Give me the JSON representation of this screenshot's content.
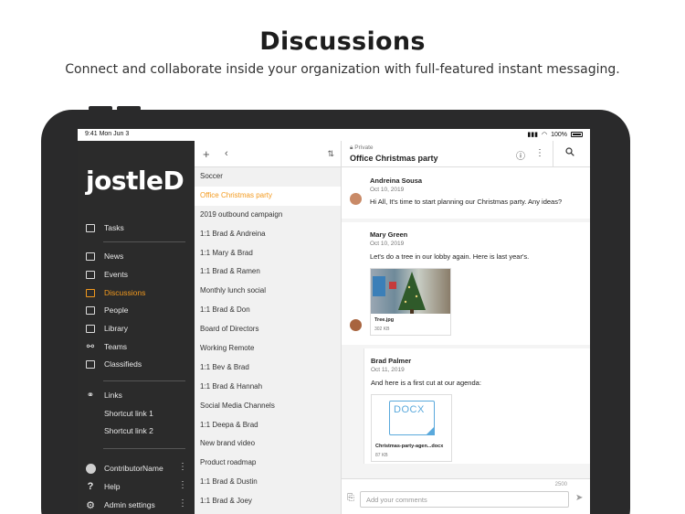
{
  "hero": {
    "title": "Discussions",
    "subtitle": "Connect and collaborate inside your organization with full-featured instant messaging."
  },
  "status_bar": {
    "time": "9:41 Mon Jun 3",
    "battery": "100%"
  },
  "logo": "jostleD",
  "nav": {
    "tasks": "Tasks",
    "news": "News",
    "events": "Events",
    "discussions": "Discussions",
    "people": "People",
    "library": "Library",
    "teams": "Teams",
    "classifieds": "Classifieds",
    "links": "Links",
    "shortcut1": "Shortcut link 1",
    "shortcut2": "Shortcut link 2",
    "user": "ContributorName",
    "help": "Help",
    "admin": "Admin settings",
    "active_color": "#f39a1e"
  },
  "discussions": [
    "Soccer",
    "Office Christmas party",
    "2019 outbound campaign",
    "1:1 Brad & Andreina",
    "1:1 Mary & Brad",
    "1:1 Brad & Ramen",
    "Monthly lunch social",
    "1:1 Brad & Don",
    "Board of Directors",
    "Working Remote",
    "1:1 Bev & Brad",
    "1:1 Brad & Hannah",
    "Social Media Channels",
    "1:1 Deepa & Brad",
    "New brand video",
    "Product roadmap",
    "1:1 Brad & Dustin",
    "1:1 Brad & Joey"
  ],
  "chat": {
    "privacy": "Private",
    "title": "Office Christmas party",
    "messages": [
      {
        "author": "Andreina Sousa",
        "date": "Oct 10, 2019",
        "text": "Hi All, It's time to start planning our Christmas party. Any ideas?"
      },
      {
        "author": "Mary Green",
        "date": "Oct 10, 2019",
        "text": "Let's do a tree in our lobby again. Here is last year's.",
        "attachment": {
          "name": "Tree.jpg",
          "size": "302 KB"
        }
      },
      {
        "author": "Brad Palmer",
        "date": "Oct 11, 2019",
        "text": "And here is a first cut at our agenda:",
        "attachment": {
          "type": "DOCX",
          "name": "Christmas-party-agen...docx",
          "size": "87 KB"
        }
      }
    ],
    "char_count": "2500",
    "comment_placeholder": "Add your comments"
  }
}
